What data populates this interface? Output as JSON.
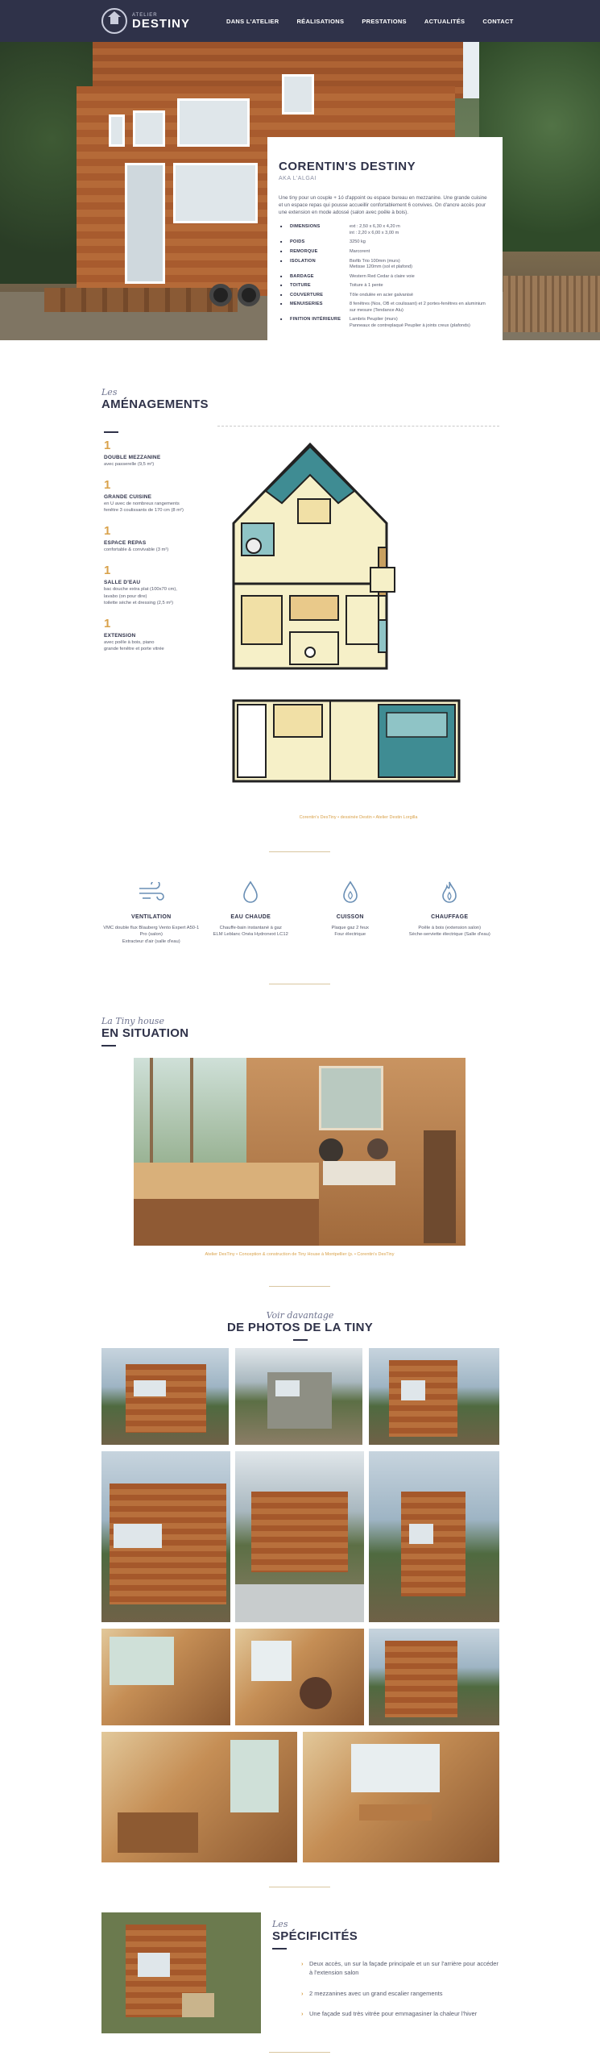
{
  "brand": {
    "small": "ATELIER",
    "name": "DESTINY"
  },
  "nav": {
    "items": [
      "DANS L'ATELIER",
      "RÉALISATIONS",
      "PRESTATIONS",
      "ACTUALITÉS",
      "CONTACT"
    ]
  },
  "card": {
    "title": "CORENTIN'S DESTINY",
    "aka": "AKA L'ALGAI",
    "description": "Une tiny pour un couple + 1ó d'appoint ou espace bureau en mezzanine. Une grande cuisine et un espace repas qui pousse accueillir confortablement 6 convives. On d'ancre accès pour une extension en mode adossé (salon avec poêle à bois).",
    "specs": [
      {
        "k": "DIMENSIONS",
        "v": "ext : 2,50 x 6,30 x 4,20 m\nint : 2,20 x 6,00 x 3,00 m"
      },
      {
        "k": "POIDS",
        "v": "3250 kg"
      },
      {
        "k": "REMORQUE",
        "v": "Marcorent"
      },
      {
        "k": "ISOLATION",
        "v": "Biofib Trio 100mm (murs)\nMetisse 120mm (sol et plafond)"
      },
      {
        "k": "BARDAGE",
        "v": "Western Red Cedar à claire voie"
      },
      {
        "k": "TOITURE",
        "v": "Toiture à 1 pente"
      },
      {
        "k": "COUVERTURE",
        "v": "Tôle ondulée en acier galvanisé"
      },
      {
        "k": "MENUISERIES",
        "v": "8 fenêtres (Nos, OB et coulissant) et 2 portes-fenêtres en aluminium sur mesure (Tendance Alu)"
      },
      {
        "k": "FINITION INTÉRIEURE",
        "v": "Lambris Peuplier (murs)\nPanneaux de contreplaqué Peuplier à joints creux (plafonds)"
      }
    ]
  },
  "amenagements": {
    "script": "Les",
    "title": "AMÉNAGEMENTS",
    "items": [
      {
        "num": "1",
        "title": "DOUBLE MEZZANINE",
        "text": "avec passerelle (9,5 m²)"
      },
      {
        "num": "1",
        "title": "GRANDE CUISINE",
        "text": "en U avec de nombreux rangements\nfenêtre 3 coulissants de 170 cm (8 m²)"
      },
      {
        "num": "1",
        "title": "ESPACE REPAS",
        "text": "confortable & convivable (3 m²)"
      },
      {
        "num": "1",
        "title": "SALLE D'EAU",
        "text": "bac douche extra plat (100x70 cm),\nlavabo (on pour dire)\ntoilette sèche et dressing (2,5 m²)"
      },
      {
        "num": "1",
        "title": "EXTENSION",
        "text": "avec poêle à bois, piano\ngrande fenêtre et porte vitrée"
      }
    ],
    "plan_caption": "Corentin's DesTiny • dessinée Destin • Atelier Destin Lorgilla"
  },
  "features": [
    {
      "icon": "wind-icon",
      "title": "VENTILATION",
      "text": "VMC double flux Blauberg Vento Expert A50-1 Pro (salon)\nExtracteur d'air (salle d'eau)"
    },
    {
      "icon": "drop-icon",
      "title": "EAU CHAUDE",
      "text": "Chauffe-bain instantané à gaz\nELM Leblanc Onéa Hydronext LC12"
    },
    {
      "icon": "drop-icon",
      "title": "CUISSON",
      "text": "Plaque gaz 2 feux\nFour électrique"
    },
    {
      "icon": "flame-icon",
      "title": "CHAUFFAGE",
      "text": "Poêle à bois (extension salon)\nSèche-serviette électrique (Salle d'eau)"
    }
  ],
  "situation": {
    "script": "La Tiny house",
    "title": "EN SITUATION",
    "caption": "Atelier DesTiny • Conception & construction de Tiny House à Montpellier (p. • Corentin's DesTiny"
  },
  "gallery": {
    "script": "Voir davantage",
    "title": "DE PHOTOS DE LA TINY"
  },
  "specificites": {
    "script": "Les",
    "title": "SPÉCIFICITÉS",
    "items": [
      "Deux accès, un sur la façade principale et un sur l'arrière pour accéder à l'extension salon",
      "2 mezzanines avec un grand escalier rangements",
      "Une façade sud très vitrée pour emmagasiner la chaleur l'hiver"
    ]
  }
}
